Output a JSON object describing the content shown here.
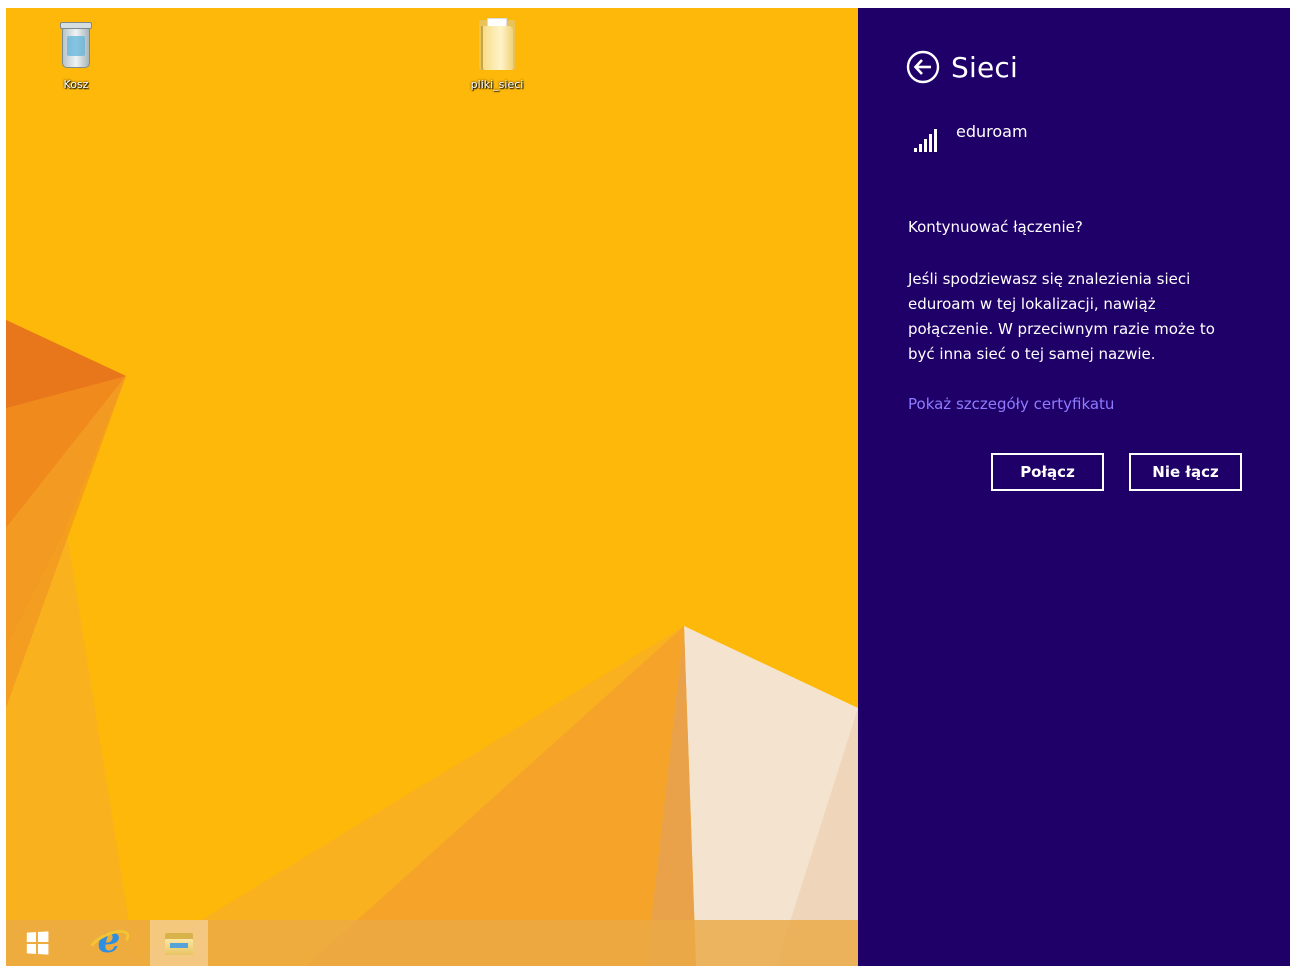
{
  "desktop": {
    "icons": [
      {
        "label": "Kosz"
      },
      {
        "label": "pliki_sieci"
      }
    ]
  },
  "taskbar": {
    "start_icon": "windows-logo-icon",
    "pinned": [
      "internet-explorer-icon",
      "file-explorer-icon"
    ],
    "active": "file-explorer"
  },
  "charm": {
    "title": "Sieci",
    "back_icon": "back-arrow-circle-icon",
    "network": {
      "name": "eduroam",
      "signal_icon": "wifi-signal-bars-icon",
      "signal_level": 1.0
    },
    "question": "Kontynuować łączenie?",
    "explanation": "Jeśli spodziewasz się znalezienia sieci eduroam w tej lokalizacji, nawiąż połączenie. W przeciwnym razie może to być inna sieć o tej samej nazwie.",
    "cert_link": "Pokaż szczegóły certyfikatu",
    "buttons": {
      "connect": "Połącz",
      "dont_connect": "Nie łącz"
    },
    "colors": {
      "background": "#1f0068",
      "link": "#8d7cff",
      "text": "#ffffff"
    }
  },
  "colors": {
    "wallpaper": "#fdb809"
  }
}
